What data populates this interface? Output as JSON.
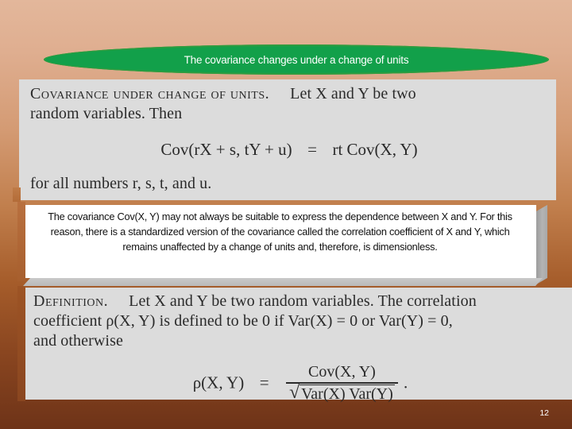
{
  "slide": {
    "title": "The covariance changes under a change of units",
    "page_number": "12",
    "accent_green": "#12a04a",
    "background_top": "#e3b79b",
    "background_bottom": "#6e3318",
    "scan_background": "#dcdcdc",
    "note_background": "#ffffff"
  },
  "theorem": {
    "heading": "Covariance under change of units.",
    "line1_rest": "Let X and Y be two",
    "line2": "random variables. Then",
    "equation": {
      "lhs": "Cov(rX + s, tY + u)",
      "relation": "=",
      "rhs": "rt Cov(X, Y)"
    },
    "closing": "for all numbers r, s, t, and u."
  },
  "note": {
    "text": "The covariance Cov(X, Y) may not always be suitable to express the dependence between X and Y. For this reason, there is a standardized version of the covariance called the correlation coefficient of X and Y, which remains unaffected by a change of units and, therefore, is dimensionless."
  },
  "definition": {
    "heading": "Definition.",
    "line1_rest": "Let X and Y be two random variables. The correlation",
    "line2": "coefficient ρ(X, Y) is defined to be 0 if Var(X) = 0 or Var(Y) = 0,",
    "line3": "and otherwise",
    "equation": {
      "lhs": "ρ(X, Y)",
      "relation": "=",
      "numerator": "Cov(X, Y)",
      "denominator": "Var(X) Var(Y)",
      "denominator_radical": "√",
      "terminator": "."
    }
  },
  "icons": {
    "radical": "√",
    "rho": "ρ"
  }
}
